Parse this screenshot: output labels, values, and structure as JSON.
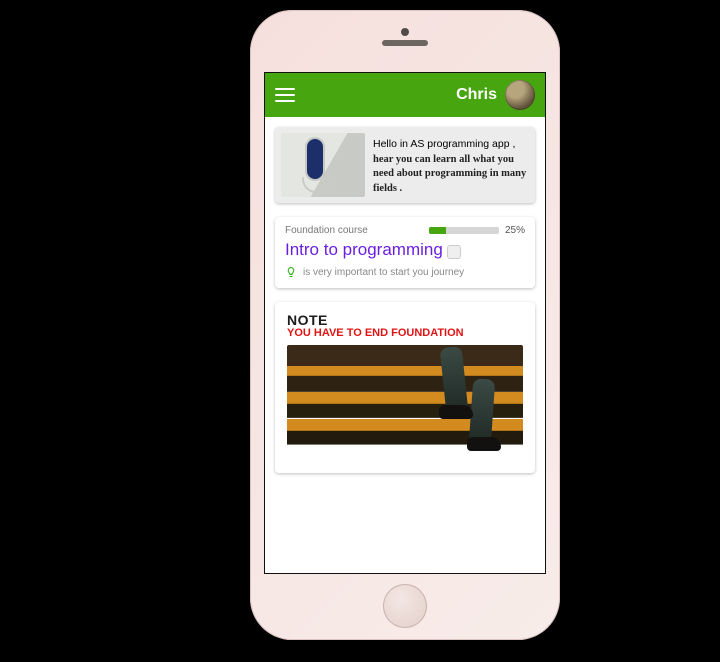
{
  "header": {
    "username": "Chris"
  },
  "welcome": {
    "greeting": "Hello in AS programming app ,",
    "subtext": "hear you can learn all what you need about programming in many fields ."
  },
  "course": {
    "category": "Foundation course",
    "progress_percent": "25%",
    "progress_value": 25,
    "title": "Intro to programming",
    "hint": "is very important to start you journey"
  },
  "note": {
    "heading": "NOTE",
    "warning": "YOU HAVE TO END FOUNDATION"
  }
}
